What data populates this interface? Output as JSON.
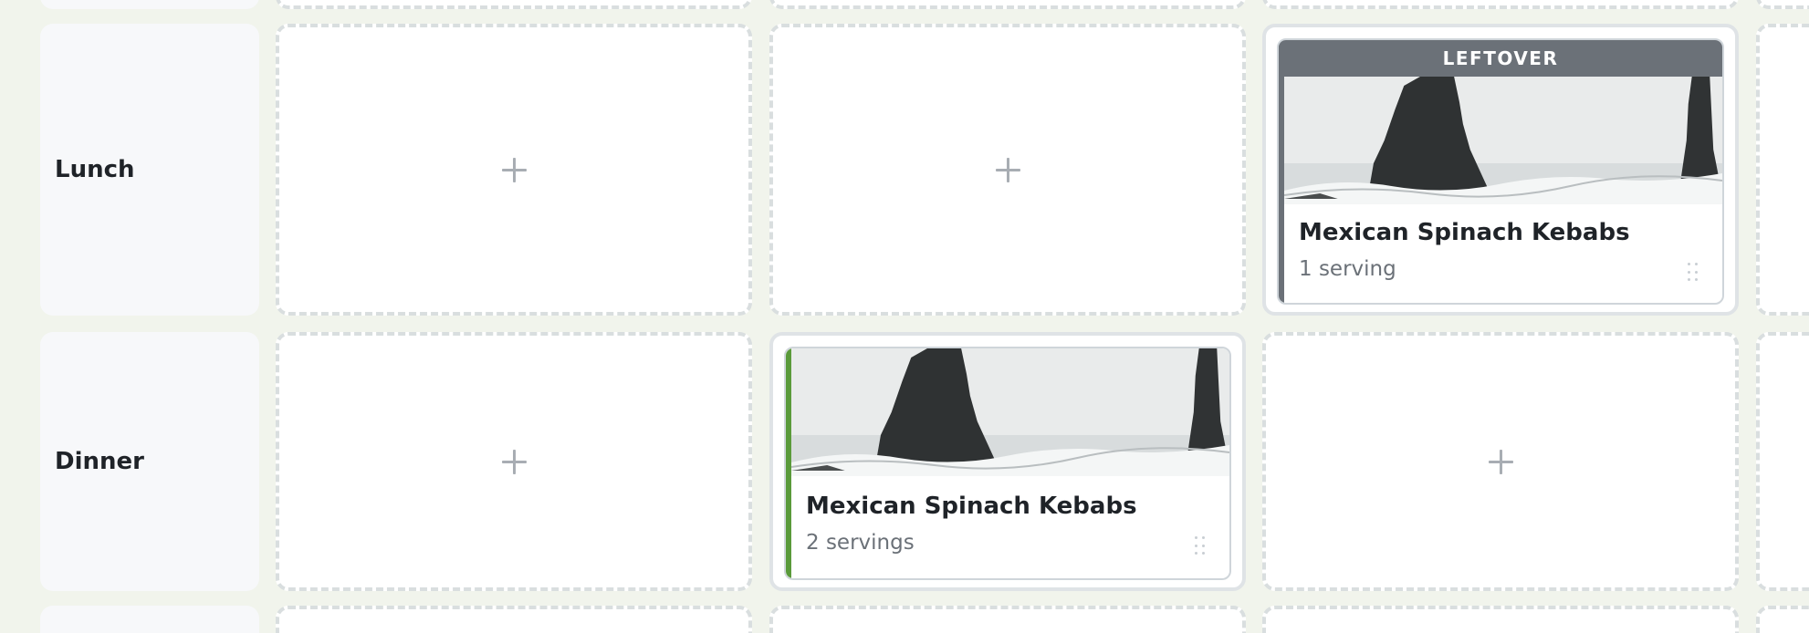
{
  "rows": [
    {
      "label": "Lunch"
    },
    {
      "label": "Dinner"
    }
  ],
  "add_slot_icon": "plus-icon",
  "meals": [
    {
      "title": "Mexican Spinach Kebabs",
      "servings": "1 serving",
      "badge": "LEFTOVER",
      "accent_color": "#6b7178",
      "badge_color": "#6b7178"
    },
    {
      "title": "Mexican Spinach Kebabs",
      "servings": "2 servings",
      "accent_color": "#5a9a3a"
    }
  ],
  "colors": {
    "background": "#f1f4ec",
    "slot_border": "#d9dedf",
    "label_bg": "#f7f8fa"
  }
}
